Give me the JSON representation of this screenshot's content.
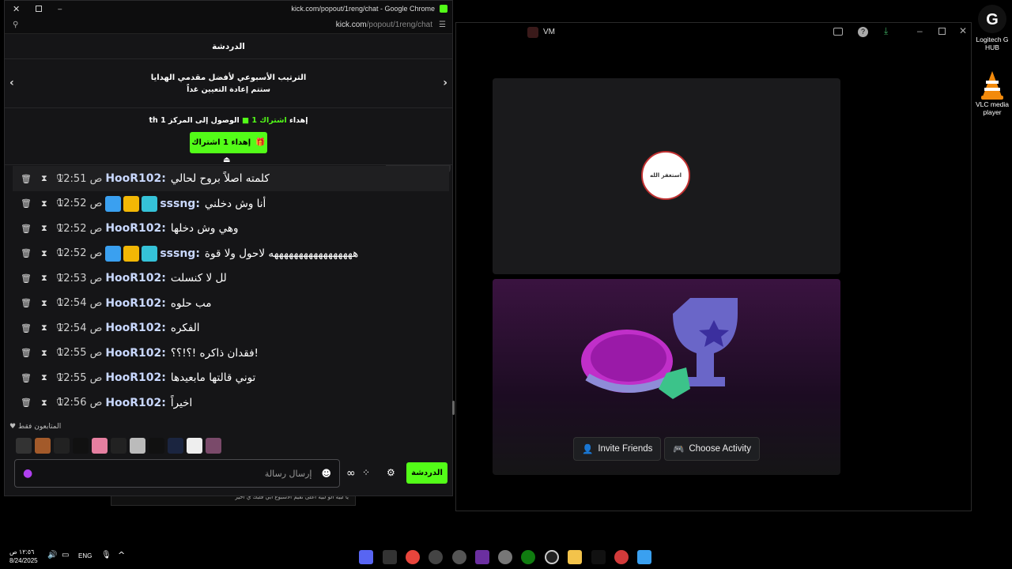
{
  "desktop": {
    "icons": [
      {
        "label": "Logitech G HUB",
        "icon": "logitech-g-icon"
      },
      {
        "label": "VLC media player",
        "icon": "vlc-cone-icon"
      }
    ]
  },
  "vm_window": {
    "title": "VM",
    "profile_card": {
      "logo_text": "استغفر الله"
    },
    "activity": {
      "invite_label": "Invite Friends",
      "choose_label": "Choose Activity"
    },
    "bottom_preview_text": "يا لبيه الو لبيه اعلى تقيم الاسبوع ابي قلبك ي اخير"
  },
  "chrome": {
    "title": "kick.com/popout/1reng/chat - Google Chrome",
    "url_host": "kick.com",
    "url_path": "/popout/1reng/chat",
    "chat_header": "الدردشة",
    "gifters": {
      "line1": "الترتيب الأسبوعي لأفضل مقدمي الهدايا",
      "line2": "ستتم إعادة التعيين غداً"
    },
    "sub_goal": {
      "text_prefix": "إهداء",
      "highlight": "اشتراك 1",
      "text_suffix": "الوصول إلى المركز 1",
      "rank_suffix": "th",
      "button_label": "إهداء 1 اشتراك"
    },
    "messages": [
      {
        "time": "ص 12:51",
        "user": "HooR102:",
        "text": "كلمته اصلاً بروح لحالي",
        "badges": []
      },
      {
        "time": "ص 12:52",
        "user": "sssng:",
        "text": "أنا وش دخلني",
        "badges": [
          "hammer",
          "crown",
          "sub"
        ]
      },
      {
        "time": "ص 12:52",
        "user": "HooR102:",
        "text": "وهي وش دخلها",
        "badges": []
      },
      {
        "time": "ص 12:52",
        "user": "sssng:",
        "text": "هههههههههههههههههه لاحول ولا قوة",
        "badges": [
          "hammer",
          "crown",
          "sub"
        ]
      },
      {
        "time": "ص 12:53",
        "user": "HooR102:",
        "text": "لل لا كنسلت",
        "badges": []
      },
      {
        "time": "ص 12:54",
        "user": "HooR102:",
        "text": "مب حلوه",
        "badges": []
      },
      {
        "time": "ص 12:54",
        "user": "HooR102:",
        "text": "الفكره",
        "badges": []
      },
      {
        "time": "ص 12:55",
        "user": "HooR102:",
        "text": "!فقدان ذاكره !؟!؟؟",
        "badges": []
      },
      {
        "time": "ص 12:55",
        "user": "HooR102:",
        "text": "توني قالتها مابعيدها",
        "badges": []
      },
      {
        "time": "ص 12:56",
        "user": "HooR102:",
        "text": "اخيراً",
        "badges": []
      }
    ],
    "followers_only_label": "المتابعون فقط",
    "input_placeholder": "إرسال رسالة",
    "chat_button": "الدردشة"
  },
  "taskbar": {
    "time": "١٢:٥٦ ص",
    "date": "8/24/2025",
    "lang": "ENG"
  },
  "colors": {
    "kick_green": "#53fc18",
    "bg_dark": "#151517",
    "username_blue": "#c9d8ff"
  }
}
